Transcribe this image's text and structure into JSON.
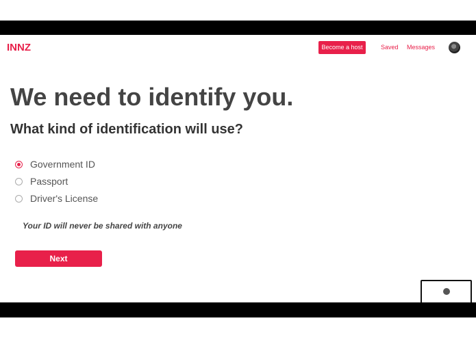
{
  "nav": {
    "logo": "INNZ",
    "become_host": "Become a host",
    "saved": "Saved",
    "messages": "Messages"
  },
  "main": {
    "title": "We need to identify you.",
    "subtitle": "What kind of identification will use?",
    "options": [
      {
        "label": "Government ID",
        "selected": true
      },
      {
        "label": "Passport",
        "selected": false
      },
      {
        "label": "Driver's License",
        "selected": false
      }
    ],
    "notice": "Your ID will never be shared with anyone",
    "next_label": "Next"
  },
  "colors": {
    "accent": "#e8204a",
    "heading": "#444444"
  }
}
